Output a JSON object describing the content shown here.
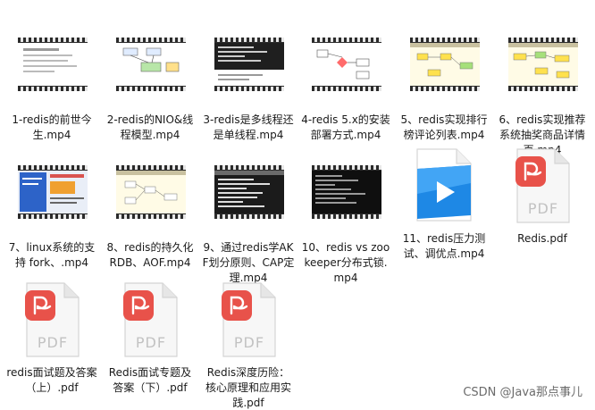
{
  "files": [
    {
      "name": "1-redis的前世今生.mp4",
      "thumb": "white-text-slide"
    },
    {
      "name": "2-redis的NIO&线程模型.mp4",
      "thumb": "white-diagram-slide"
    },
    {
      "name": "3-redis是多线程还是单线程.mp4",
      "thumb": "terminal-slide"
    },
    {
      "name": "4-redis 5.x的安装部署方式.mp4",
      "thumb": "flow-diagram-slide"
    },
    {
      "name": "5、redis实现排行榜评论列表.mp4",
      "thumb": "yellow-flow-slide"
    },
    {
      "name": "6、redis实现推荐系统抽奖商品详情页.mp4",
      "thumb": "yellow-flow-slide"
    },
    {
      "name": "7、linux系统的支持 fork、.mp4",
      "thumb": "blue-slide"
    },
    {
      "name": "8、redis的持久化 RDB、AOF.mp4",
      "thumb": "yellow-diagram-slide"
    },
    {
      "name": "9、通过redis学AKF划分原则、CAP定理.mp4",
      "thumb": "terminal-slide"
    },
    {
      "name": "10、redis vs zookeeper分布式锁.mp4",
      "thumb": "dark-terminal-slide"
    },
    {
      "name": "11、redis压力测试、调优点.mp4",
      "thumb": "video-player-icon"
    },
    {
      "name": "Redis.pdf",
      "thumb": "pdf-icon"
    },
    {
      "name": "redis面试题及答案（上）.pdf",
      "thumb": "pdf-icon"
    },
    {
      "name": "Redis面试专题及答案（下）.pdf",
      "thumb": "pdf-icon"
    },
    {
      "name": "Redis深度历险：核心原理和应用实践.pdf",
      "thumb": "pdf-icon"
    }
  ],
  "watermark": "CSDN @Java那点事儿",
  "colors": {
    "pdf_red": "#e8524a",
    "player_blue": "#1e88e5"
  }
}
